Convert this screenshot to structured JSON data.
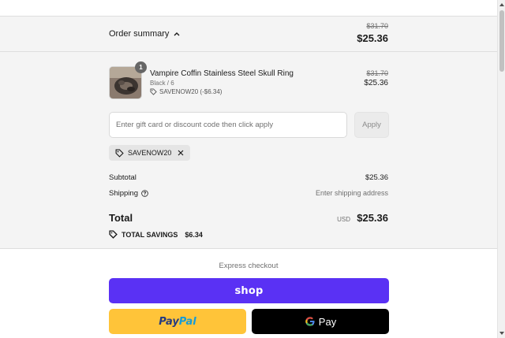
{
  "order_summary": {
    "toggle_label": "Order summary",
    "header_compare_price": "$31.70",
    "header_total": "$25.36"
  },
  "line_item": {
    "quantity": "1",
    "name": "Vampire Coffin Stainless Steel Skull Ring",
    "variant": "Black / 6",
    "discount": "SAVENOW20 (-$6.34)",
    "compare_price": "$31.70",
    "price": "$25.36"
  },
  "discount_form": {
    "placeholder": "Enter gift card or discount code then click apply",
    "value": "",
    "apply_label": "Apply"
  },
  "applied_code": {
    "code": "SAVENOW20"
  },
  "totals": {
    "subtotal_label": "Subtotal",
    "subtotal_value": "$25.36",
    "shipping_label": "Shipping",
    "shipping_value": "Enter shipping address",
    "total_label": "Total",
    "currency": "USD",
    "total_value": "$25.36",
    "savings_label": "TOTAL SAVINGS",
    "savings_value": "$6.34"
  },
  "express_checkout": {
    "label": "Express checkout",
    "shop_label": "shop",
    "paypal_part1": "Pay",
    "paypal_part2": "Pal",
    "gpay_label": "Pay"
  },
  "colors": {
    "shop_purple": "#5a31f4",
    "paypal_yellow": "#ffc439",
    "gpay_black": "#000000",
    "panel_gray": "#f4f4f4"
  },
  "icons": [
    "chevron-up-icon",
    "tag-icon",
    "close-icon",
    "question-circle-icon",
    "savings-tag-icon",
    "google-g-icon"
  ]
}
